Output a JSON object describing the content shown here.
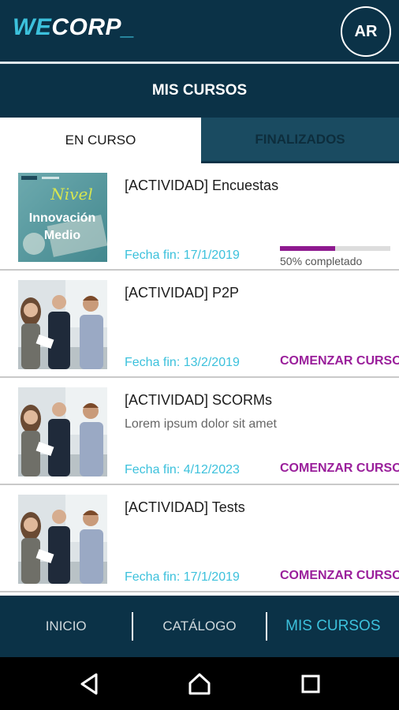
{
  "header": {
    "logo": {
      "we": "WE",
      "corp": "CORP",
      "underscore": "_"
    },
    "avatar_initials": "AR"
  },
  "page": {
    "title": "MIS CURSOS"
  },
  "tabs": [
    {
      "label": "EN CURSO",
      "active": true
    },
    {
      "label": "FINALIZADOS",
      "active": false
    }
  ],
  "courses": [
    {
      "title": "[ACTIVIDAD] Encuestas",
      "subtitle": "",
      "date": "Fecha fin: 17/1/2019",
      "progress": 0.5,
      "progress_label": "50% completado",
      "thumb": {
        "script": "Nivel",
        "line1": "Innovación",
        "line2": "Medio"
      }
    },
    {
      "title": "[ACTIVIDAD] P2P",
      "subtitle": "",
      "date": "Fecha fin: 13/2/2019",
      "action": "COMENZAR CURSO"
    },
    {
      "title": "[ACTIVIDAD] SCORMs",
      "subtitle": "Lorem ipsum dolor sit amet",
      "date": "Fecha fin: 4/12/2023",
      "action": "COMENZAR CURSO"
    },
    {
      "title": "[ACTIVIDAD] Tests",
      "subtitle": "",
      "date": "Fecha fin: 17/1/2019",
      "action": "COMENZAR CURSO"
    }
  ],
  "bottom_nav": [
    {
      "label": "INICIO",
      "active": false
    },
    {
      "label": "CATÁLOGO",
      "active": false
    },
    {
      "label": "MIS CURSOS",
      "active": true
    }
  ],
  "colors": {
    "primary": "#0b3247",
    "accent": "#3cc1dc",
    "action": "#9a1f9b",
    "progress": "#8e1a8f"
  },
  "icons": {
    "system_back": "back-triangle-icon",
    "system_home": "home-icon",
    "system_recents": "recents-square-icon"
  }
}
